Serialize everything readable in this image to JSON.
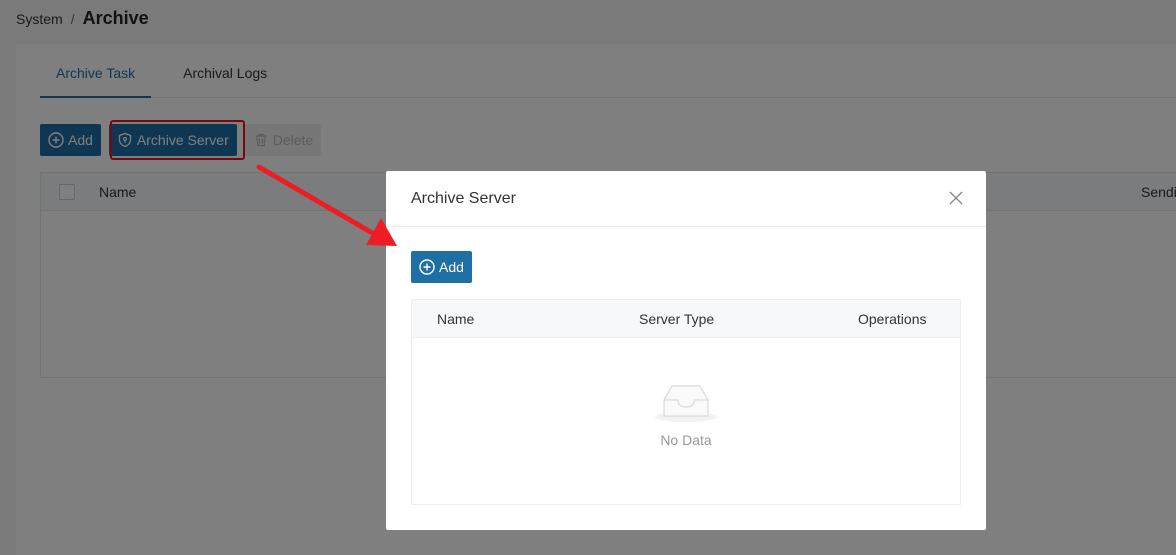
{
  "breadcrumb": {
    "parent": "System",
    "separator": "/",
    "current": "Archive"
  },
  "tabs": [
    {
      "label": "Archive Task",
      "active": true
    },
    {
      "label": "Archival Logs",
      "active": false
    }
  ],
  "toolbar": {
    "add_label": "Add",
    "archive_server_label": "Archive Server",
    "delete_label": "Delete"
  },
  "main_table": {
    "columns": [
      "Name",
      "Sendi"
    ]
  },
  "modal": {
    "title": "Archive Server",
    "close_symbol": "X",
    "add_label": "Add",
    "columns": [
      "Name",
      "Server Type",
      "Operations"
    ],
    "empty_text": "No Data"
  },
  "colors": {
    "primary": "#1f6fa7",
    "highlight": "#e8141b",
    "arrow": "#ee1c24"
  },
  "icons": [
    "plus-circle-icon",
    "shield-icon",
    "trash-icon",
    "close-icon",
    "empty-inbox-icon"
  ]
}
